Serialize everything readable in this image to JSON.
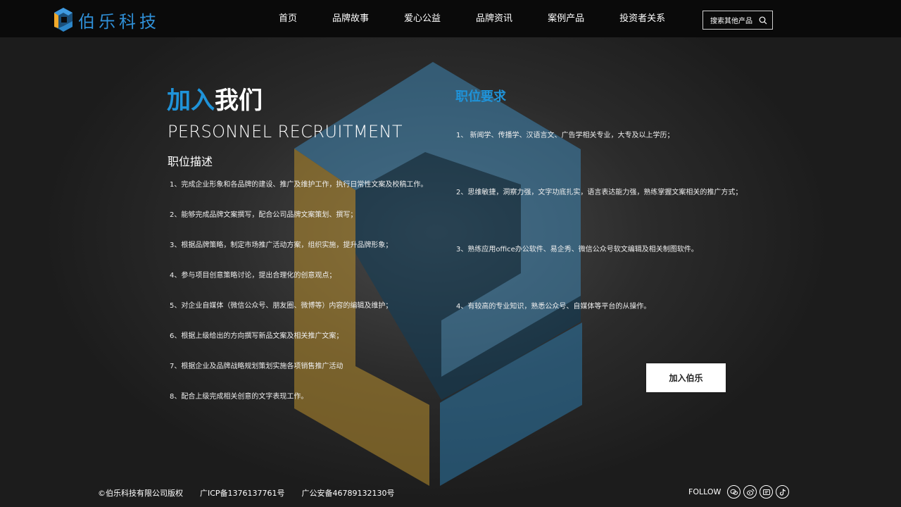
{
  "brand": {
    "name": "伯乐科技",
    "accent_color": "#1f93d9",
    "logo_icon": "b-cube-logo-icon"
  },
  "nav": {
    "items": [
      "首页",
      "品牌故事",
      "爱心公益",
      "品牌资讯",
      "案例产品",
      "投资者关系"
    ]
  },
  "search": {
    "label": "搜索其他产品",
    "icon": "search-icon"
  },
  "recruit": {
    "title_blue": "加入",
    "title_white": "我们",
    "subtitle": "PERSONNEL RECRUITMENT",
    "description_heading": "职位描述",
    "description_items": [
      "1、完成企业形象和各品牌的建设、推广及维护工作，执行日常性文案及校稿工作。",
      "2、能够完成品牌文案撰写，配合公司品牌文案策划、撰写；",
      "3、根据品牌策略，制定市场推广活动方案，组织实施，提升品牌形象；",
      "4、参与项目创意策略讨论，提出合理化的创意观点；",
      "5、对企业自媒体（微信公众号、朋友圈、微博等）内容的编辑及维护；",
      "6、根据上级给出的方向撰写新品文案及相关推广文案；",
      "7、根据企业及品牌战略规划策划实施各项销售推广活动",
      "8、配合上级完成相关创意的文字表现工作。"
    ],
    "requirements_heading": "职位要求",
    "requirements_items": [
      "1、 新闻学、传播学、汉语言文、广告学相关专业，大专及以上学历；",
      "2、思维敏捷，洞察力强，文字功底扎实，语言表达能力强，熟练掌握文案相关的推广方式；",
      "3、熟练应用office办公软件、易企秀、微信公众号软文编辑及相关制图软件。",
      "4、有较高的专业知识，熟悉公众号、自媒体等平台的从操作。"
    ],
    "join_button": "加入伯乐"
  },
  "footer": {
    "copyright_mark": "©",
    "copyright": "伯乐科技有限公司版权",
    "icp": "广ICP备1376137761号",
    "security": "广公安备46789132130号",
    "follow_label": "FOLLOW",
    "social_icons": [
      "wechat-icon",
      "weibo-icon",
      "message-icon",
      "tiktok-icon"
    ]
  }
}
